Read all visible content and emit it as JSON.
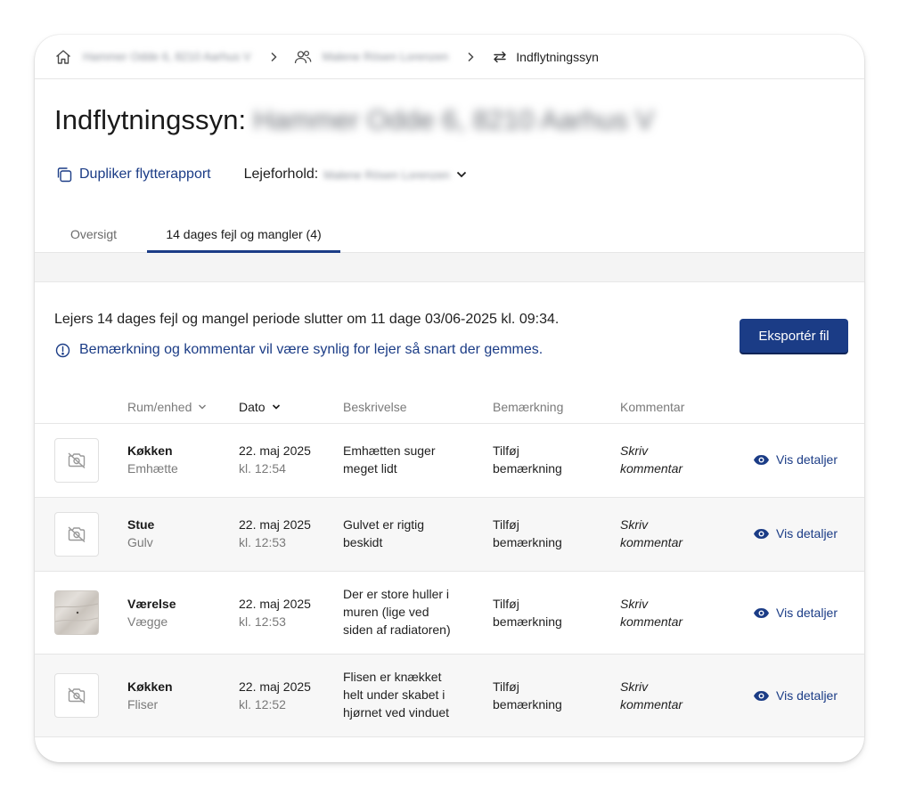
{
  "breadcrumb": {
    "address": "Hammer Odde 6, 8210 Aarhus V",
    "tenant": "Malene Rösen Lorenzen",
    "current": "Indflytningssyn"
  },
  "header": {
    "title": "Indflytningssyn:",
    "address": "Hammer Odde 6, 8210 Aarhus V",
    "duplicate_label": "Dupliker flytterapport",
    "lease_label": "Lejeforhold:",
    "lease_value": "Malene Rösen Lorenzen"
  },
  "tabs": [
    {
      "label": "Oversigt",
      "active": false
    },
    {
      "label": "14 dages fejl og mangler (4)",
      "active": true
    }
  ],
  "info": {
    "period_text": "Lejers 14 dages fejl og mangel periode slutter om 11 dage 03/06-2025 kl. 09:34.",
    "notice_text": "Bemærkning og kommentar vil være synlig for lejer så snart der gemmes.",
    "export_label": "Eksportér fil"
  },
  "table": {
    "columns": {
      "room": "Rum/enhed",
      "date": "Dato",
      "description": "Beskrivelse",
      "remark": "Bemærkning",
      "comment": "Kommentar"
    },
    "rows": [
      {
        "room": "Køkken",
        "unit": "Emhætte",
        "date": "22. maj 2025",
        "time": "kl. 12:54",
        "desc1": "Emhætten suger",
        "desc2": "meget lidt",
        "desc3": "",
        "remark1": "Tilføj",
        "remark2": "bemærkning",
        "comment1": "Skriv",
        "comment2": "kommentar",
        "details": "Vis detaljer",
        "has_photo": false
      },
      {
        "room": "Stue",
        "unit": "Gulv",
        "date": "22. maj 2025",
        "time": "kl. 12:53",
        "desc1": "Gulvet er rigtig",
        "desc2": "beskidt",
        "desc3": "",
        "remark1": "Tilføj",
        "remark2": "bemærkning",
        "comment1": "Skriv",
        "comment2": "kommentar",
        "details": "Vis detaljer",
        "has_photo": false
      },
      {
        "room": "Værelse",
        "unit": "Vægge",
        "date": "22. maj 2025",
        "time": "kl. 12:53",
        "desc1": "Der er store huller i",
        "desc2": "muren (lige ved",
        "desc3": "siden af radiatoren)",
        "remark1": "Tilføj",
        "remark2": "bemærkning",
        "comment1": "Skriv",
        "comment2": "kommentar",
        "details": "Vis detaljer",
        "has_photo": true
      },
      {
        "room": "Køkken",
        "unit": "Fliser",
        "date": "22. maj 2025",
        "time": "kl. 12:52",
        "desc1": "Flisen er knækket",
        "desc2": "helt under skabet i",
        "desc3": "hjørnet ved vinduet",
        "remark1": "Tilføj",
        "remark2": "bemærkning",
        "comment1": "Skriv",
        "comment2": "kommentar",
        "details": "Vis detaljer",
        "has_photo": false
      }
    ]
  },
  "colors": {
    "primary": "#1b3c86",
    "row_alt": "#f7f7f7",
    "muted": "#7a7a7a"
  }
}
